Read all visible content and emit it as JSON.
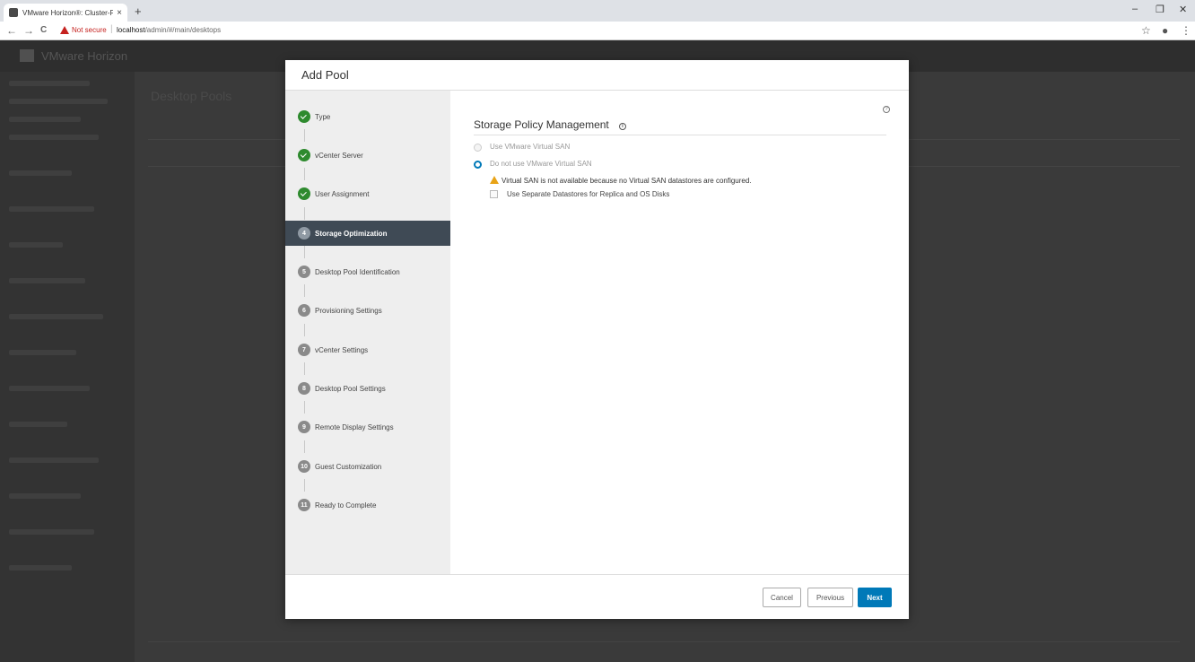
{
  "browser": {
    "tab_title": "VMware Horizon®: Cluster-FS-V",
    "tab_close": "×",
    "new_tab": "+",
    "minimize": "–",
    "restore": "❐",
    "close": "✕",
    "back": "←",
    "forward": "→",
    "reload": "C",
    "not_secure": "Not secure",
    "url_host": "localhost",
    "url_path": "/admin/#/main/desktops",
    "bookmark": "☆",
    "account": "●",
    "menu": "⋮"
  },
  "app": {
    "brand": "VMware Horizon",
    "page_title": "Desktop Pools"
  },
  "modal": {
    "title": "Add Pool",
    "steps": [
      {
        "num": "1",
        "label": "Type",
        "state": "done"
      },
      {
        "num": "2",
        "label": "vCenter Server",
        "state": "done"
      },
      {
        "num": "3",
        "label": "User Assignment",
        "state": "done"
      },
      {
        "num": "4",
        "label": "Storage Optimization",
        "state": "active"
      },
      {
        "num": "5",
        "label": "Desktop Pool Identification",
        "state": "pending"
      },
      {
        "num": "6",
        "label": "Provisioning Settings",
        "state": "pending"
      },
      {
        "num": "7",
        "label": "vCenter Settings",
        "state": "pending"
      },
      {
        "num": "8",
        "label": "Desktop Pool Settings",
        "state": "pending"
      },
      {
        "num": "9",
        "label": "Remote Display Settings",
        "state": "pending"
      },
      {
        "num": "10",
        "label": "Guest Customization",
        "state": "pending"
      },
      {
        "num": "11",
        "label": "Ready to Complete",
        "state": "pending"
      }
    ],
    "content": {
      "help": "?",
      "section_title": "Storage Policy Management",
      "info": "i",
      "option_vsan": "Use VMware Virtual SAN",
      "option_no_vsan": "Do not use VMware Virtual SAN",
      "selected_option": "Do not use VMware Virtual SAN",
      "warning": "Virtual SAN is not available because no Virtual SAN datastores are configured.",
      "checkbox_label": "Use Separate Datastores for Replica and OS Disks",
      "checkbox_checked": false
    },
    "footer": {
      "cancel": "Cancel",
      "previous": "Previous",
      "next": "Next"
    }
  },
  "colors": {
    "accent": "#0079b8",
    "done": "#2e8a2e",
    "active_step_bg": "#3f4a55",
    "warning": "#e8a317",
    "not_secure": "#c5221f"
  }
}
